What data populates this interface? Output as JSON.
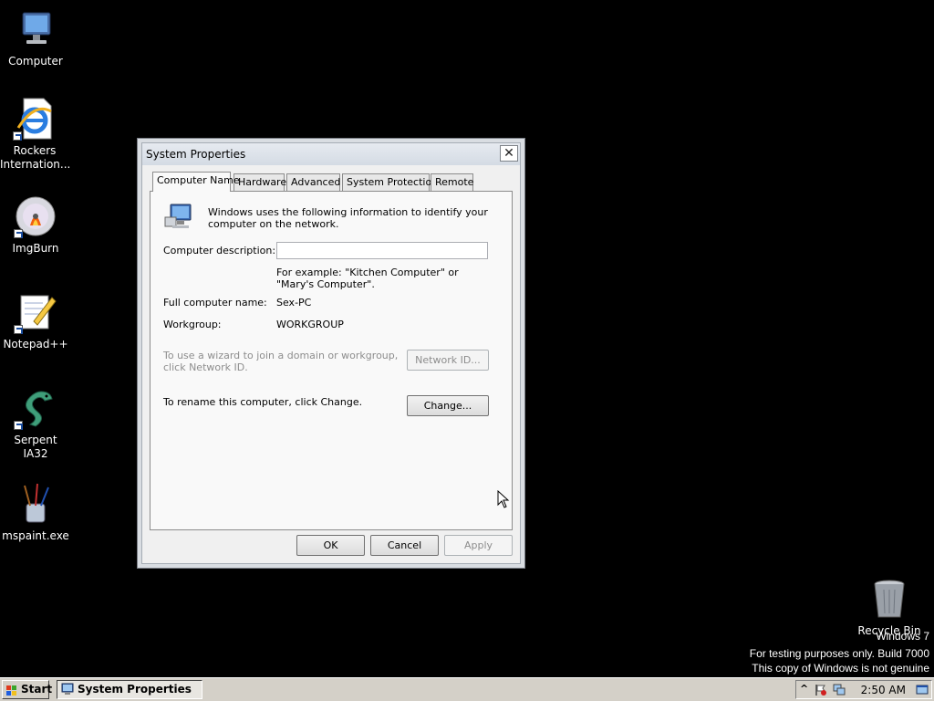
{
  "desktop": {
    "icons": [
      {
        "label": "Computer",
        "icon": "computer-icon"
      },
      {
        "label_line1": "Rockers",
        "label_line2": "Internation...",
        "icon": "internet-explorer-icon"
      },
      {
        "label": "ImgBurn",
        "icon": "imgburn-disc-icon"
      },
      {
        "label": "Notepad++",
        "icon": "notepad-plus-plus-icon"
      },
      {
        "label": "Serpent IA32",
        "icon": "serpent-icon"
      },
      {
        "label": "mspaint.exe",
        "icon": "paint-brushes-icon"
      },
      {
        "label": "Recycle Bin",
        "icon": "recycle-bin-icon"
      }
    ],
    "watermark": {
      "line1": "Windows  7",
      "line2": "For testing purposes only. Build 7000",
      "line3": "This copy of Windows is not genuine"
    }
  },
  "dialog": {
    "title": "System Properties",
    "close_glyph": "✕",
    "tabs": [
      "Computer Name",
      "Hardware",
      "Advanced",
      "System Protection",
      "Remote"
    ],
    "active_tab": "Computer Name",
    "intro": "Windows uses the following information to identify your computer on the network.",
    "description_label": "Computer description:",
    "description_value": "",
    "example_text": "For example: \"Kitchen Computer\" or \"Mary's Computer\".",
    "full_name_label": "Full computer name:",
    "full_name_value": "Sex-PC",
    "workgroup_label": "Workgroup:",
    "workgroup_value": "WORKGROUP",
    "network_id_text": "To use a wizard to join a domain or workgroup, click Network ID.",
    "network_id_button": "Network ID...",
    "rename_text": "To rename this computer, click Change.",
    "change_button": "Change...",
    "ok_button": "OK",
    "cancel_button": "Cancel",
    "apply_button": "Apply"
  },
  "taskbar": {
    "start_label": "Start",
    "task_label": "System Properties",
    "clock": "2:50 AM",
    "tray_expand_glyph": "^"
  },
  "colors": {
    "desktop_bg": "#000000",
    "taskbar_bg": "#d4d0c8",
    "dialog_bg": "#f0f0f0"
  }
}
